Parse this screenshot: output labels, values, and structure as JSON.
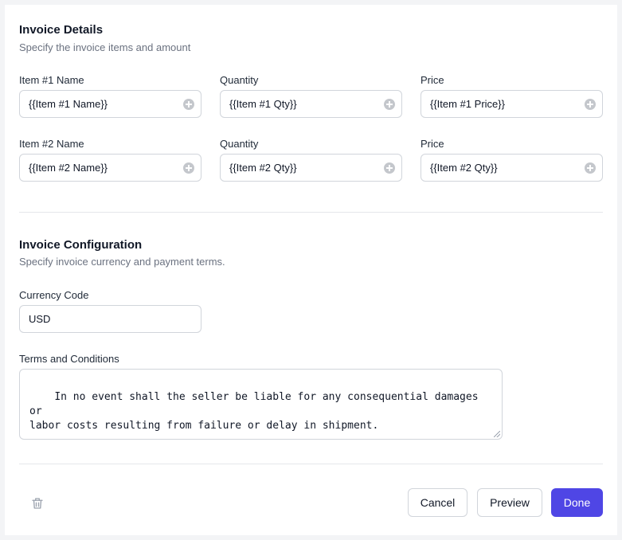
{
  "invoice_details": {
    "title": "Invoice Details",
    "subtitle": "Specify the invoice items and amount",
    "rows": [
      {
        "name_label": "Item #1 Name",
        "name_value": "{{Item #1 Name}}",
        "qty_label": "Quantity",
        "qty_value": "{{Item #1 Qty}}",
        "price_label": "Price",
        "price_value": "{{Item #1 Price}}"
      },
      {
        "name_label": "Item #2 Name",
        "name_value": "{{Item #2 Name}}",
        "qty_label": "Quantity",
        "qty_value": "{{Item #2 Qty}}",
        "price_label": "Price",
        "price_value": "{{Item #2 Qty}}"
      }
    ]
  },
  "invoice_configuration": {
    "title": "Invoice Configuration",
    "subtitle": "Specify invoice currency and payment terms.",
    "currency_label": "Currency Code",
    "currency_value": "USD",
    "terms_label": "Terms and Conditions",
    "terms_value": "In no event shall the seller be liable for any consequential damages or\nlabor costs resulting from failure or delay in shipment."
  },
  "footer": {
    "cancel_label": "Cancel",
    "preview_label": "Preview",
    "done_label": "Done",
    "delete_icon": "trash-icon"
  },
  "colors": {
    "primary": "#4f46e5",
    "border": "#d1d5db",
    "muted_text": "#6b7280"
  }
}
